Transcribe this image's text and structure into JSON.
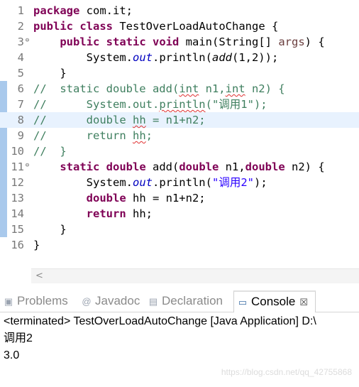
{
  "editor": {
    "lines": [
      {
        "num": "1"
      },
      {
        "num": "2"
      },
      {
        "num": "3"
      },
      {
        "num": "4"
      },
      {
        "num": "5"
      },
      {
        "num": "6"
      },
      {
        "num": "7"
      },
      {
        "num": "8"
      },
      {
        "num": "9"
      },
      {
        "num": "10"
      },
      {
        "num": "11"
      },
      {
        "num": "12"
      },
      {
        "num": "13"
      },
      {
        "num": "14"
      },
      {
        "num": "15"
      },
      {
        "num": "16"
      }
    ],
    "current_line": "8",
    "colors": {
      "keyword": "#7f0055",
      "comment": "#3f7f5f",
      "string": "#2a00ff",
      "field": "#0000c0",
      "current_line_bg": "#e8f2fe",
      "change_bar": "#a9c9ec"
    }
  },
  "tokens": {
    "package_kw": "package",
    "package_name": " com.it;",
    "public_kw": "public",
    "class_kw": "class",
    "class_name": " TestOverLoadAutoChange {",
    "static_kw": "static",
    "void_kw": "void",
    "main_sig_1": " main(String[] ",
    "args": "args",
    "main_sig_2": ") {",
    "system": "System.",
    "out": "out",
    "println_open": ".println(",
    "add_call": "add",
    "add_args": "(1,2));",
    "close_brace": "}",
    "c6_a": "//  static double add(",
    "c6_int1": "int",
    "c6_b": " n1,",
    "c6_int2": "int",
    "c6_c": " n2) {",
    "c7_a": "//      System.out.",
    "c7_println": "println",
    "c7_b": "(\"调用1\");",
    "c8_a": "//      double ",
    "c8_hh": "hh",
    "c8_b": " = n1+n2;",
    "c9_a": "//      return ",
    "c9_hh": "hh",
    "c9_b": ";",
    "c10": "//  }",
    "double_kw": "double",
    "add_sig_1": " add(",
    "add_sig_2": " n1,",
    "add_sig_3": " n2) {",
    "println_rest": ".println(",
    "str_call2": "\"调用2\"",
    "semi_close": ");",
    "hh_assign": " hh = n1+n2;",
    "return_kw": "return",
    "return_hh": " hh;"
  },
  "scrollbar": {
    "left_arrow": "<"
  },
  "tabs": [
    {
      "label": "Problems",
      "icon": "problems-icon"
    },
    {
      "label": "Javadoc",
      "icon": "@"
    },
    {
      "label": "Declaration",
      "icon": "declaration-icon"
    },
    {
      "label": "Console",
      "icon": "console-icon",
      "close": "☒"
    }
  ],
  "console": {
    "status": "<terminated> TestOverLoadAutoChange [Java Application] D:\\",
    "output": [
      "调用2",
      "3.0"
    ]
  },
  "watermark": "https://blog.csdn.net/qq_42755868"
}
